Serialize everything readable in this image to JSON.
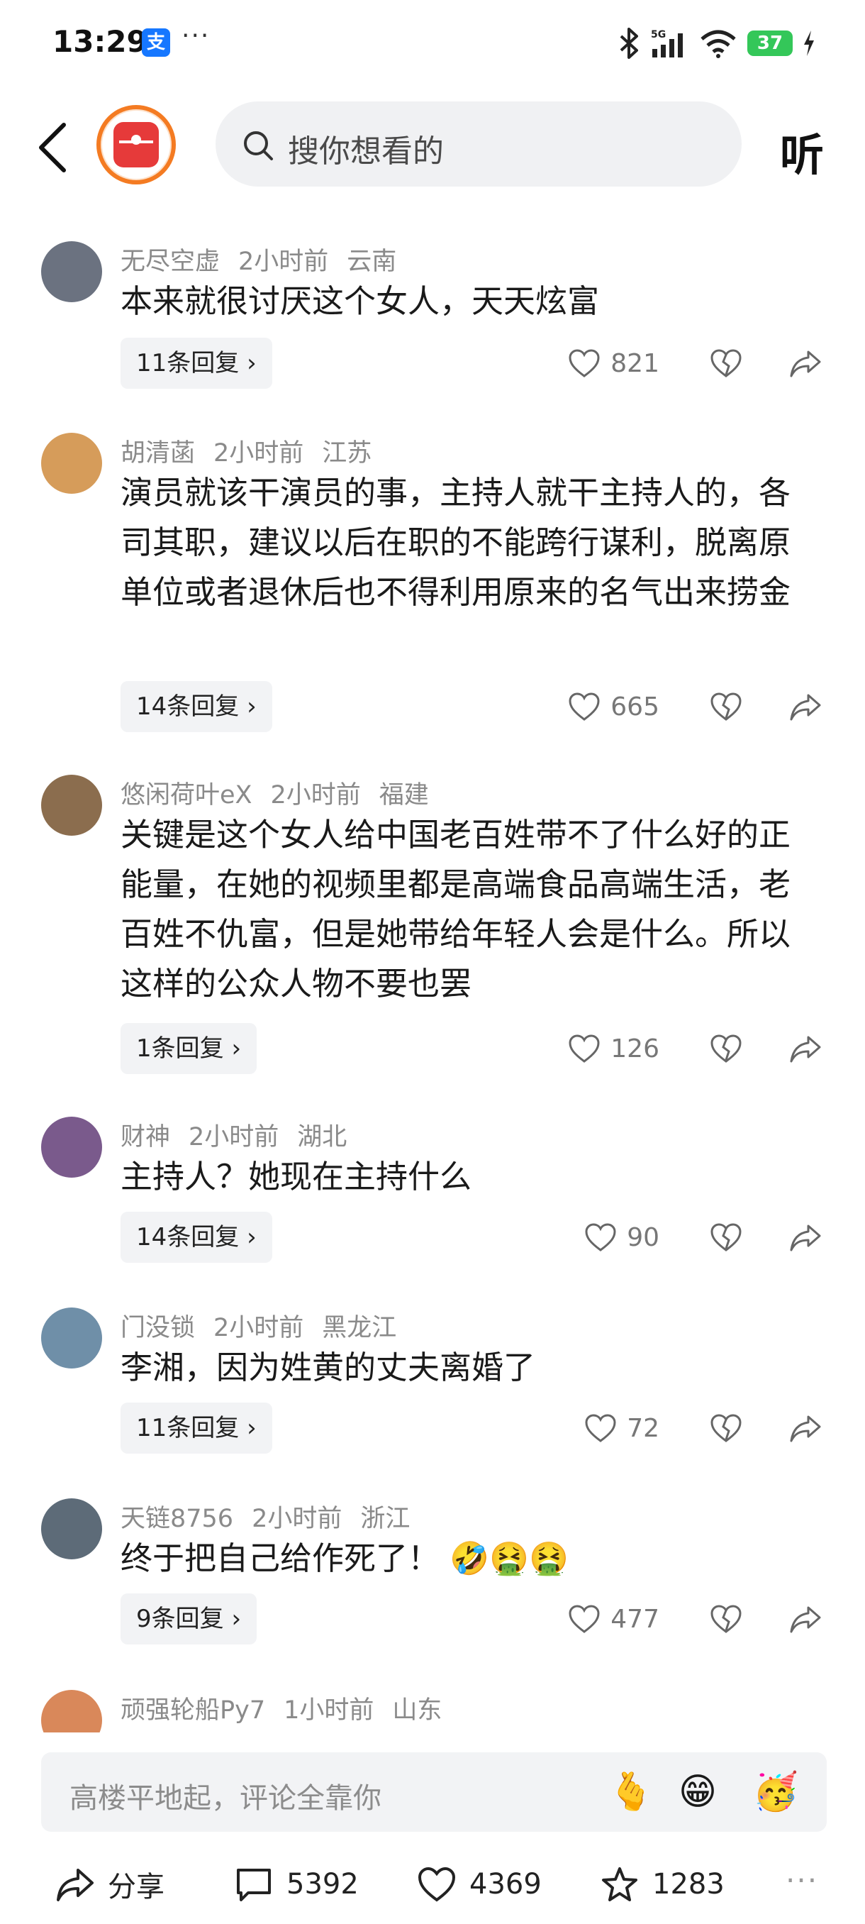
{
  "status_bar": {
    "time": "13:29",
    "app_badge": "支",
    "dots": "···",
    "network": "5G",
    "battery": "37"
  },
  "top_nav": {
    "search_placeholder": "搜你想看的",
    "listen_label": "听"
  },
  "comments": [
    {
      "user": "无尽空虚",
      "time": "2小时前",
      "location": "云南",
      "text": "本来就很讨厌这个女人，天天炫富",
      "replies": "11条回复",
      "likes": "821",
      "avatar_color": "#6b7280"
    },
    {
      "user": "胡清菡",
      "time": "2小时前",
      "location": "江苏",
      "text": "演员就该干演员的事，主持人就干主持人的，各司其职，建议以后在职的不能跨行谋利，脱离原单位或者退休后也不得利用原来的名气出来捞金",
      "replies": "14条回复",
      "likes": "665",
      "avatar_color": "#d69c5a"
    },
    {
      "user": "悠闲荷叶eX",
      "time": "2小时前",
      "location": "福建",
      "text": "关键是这个女人给中国老百姓带不了什么好的正能量，在她的视频里都是高端食品高端生活，老百姓不仇富，但是她带给年轻人会是什么。所以这样的公众人物不要也罢",
      "replies": "1条回复",
      "likes": "126",
      "avatar_color": "#8b6d4e"
    },
    {
      "user": "财神",
      "time": "2小时前",
      "location": "湖北",
      "text": "主持人？她现在主持什么",
      "replies": "14条回复",
      "likes": "90",
      "avatar_color": "#7a5a8c"
    },
    {
      "user": "门没锁",
      "time": "2小时前",
      "location": "黑龙江",
      "text": "李湘，因为姓黄的丈夫离婚了",
      "replies": "11条回复",
      "likes": "72",
      "avatar_color": "#6f8fa8"
    },
    {
      "user": "天链8756",
      "time": "2小时前",
      "location": "浙江",
      "text": "终于把自己给作死了！",
      "emojis": "🤣🤮🤮",
      "replies": "9条回复",
      "likes": "477",
      "avatar_color": "#5d6b78"
    },
    {
      "user": "顽强轮船Py7",
      "time": "1小时前",
      "location": "山东",
      "avatar_color": "#d9885a"
    }
  ],
  "comment_input": {
    "placeholder": "高楼平地起，评论全靠你",
    "emoji_1": "🫰",
    "emoji_2": "😁",
    "emoji_3": "🥳"
  },
  "bottom_bar": {
    "share_label": "分享",
    "comment_count": "5392",
    "like_count": "4369",
    "favorite_count": "1283",
    "more": "···"
  }
}
